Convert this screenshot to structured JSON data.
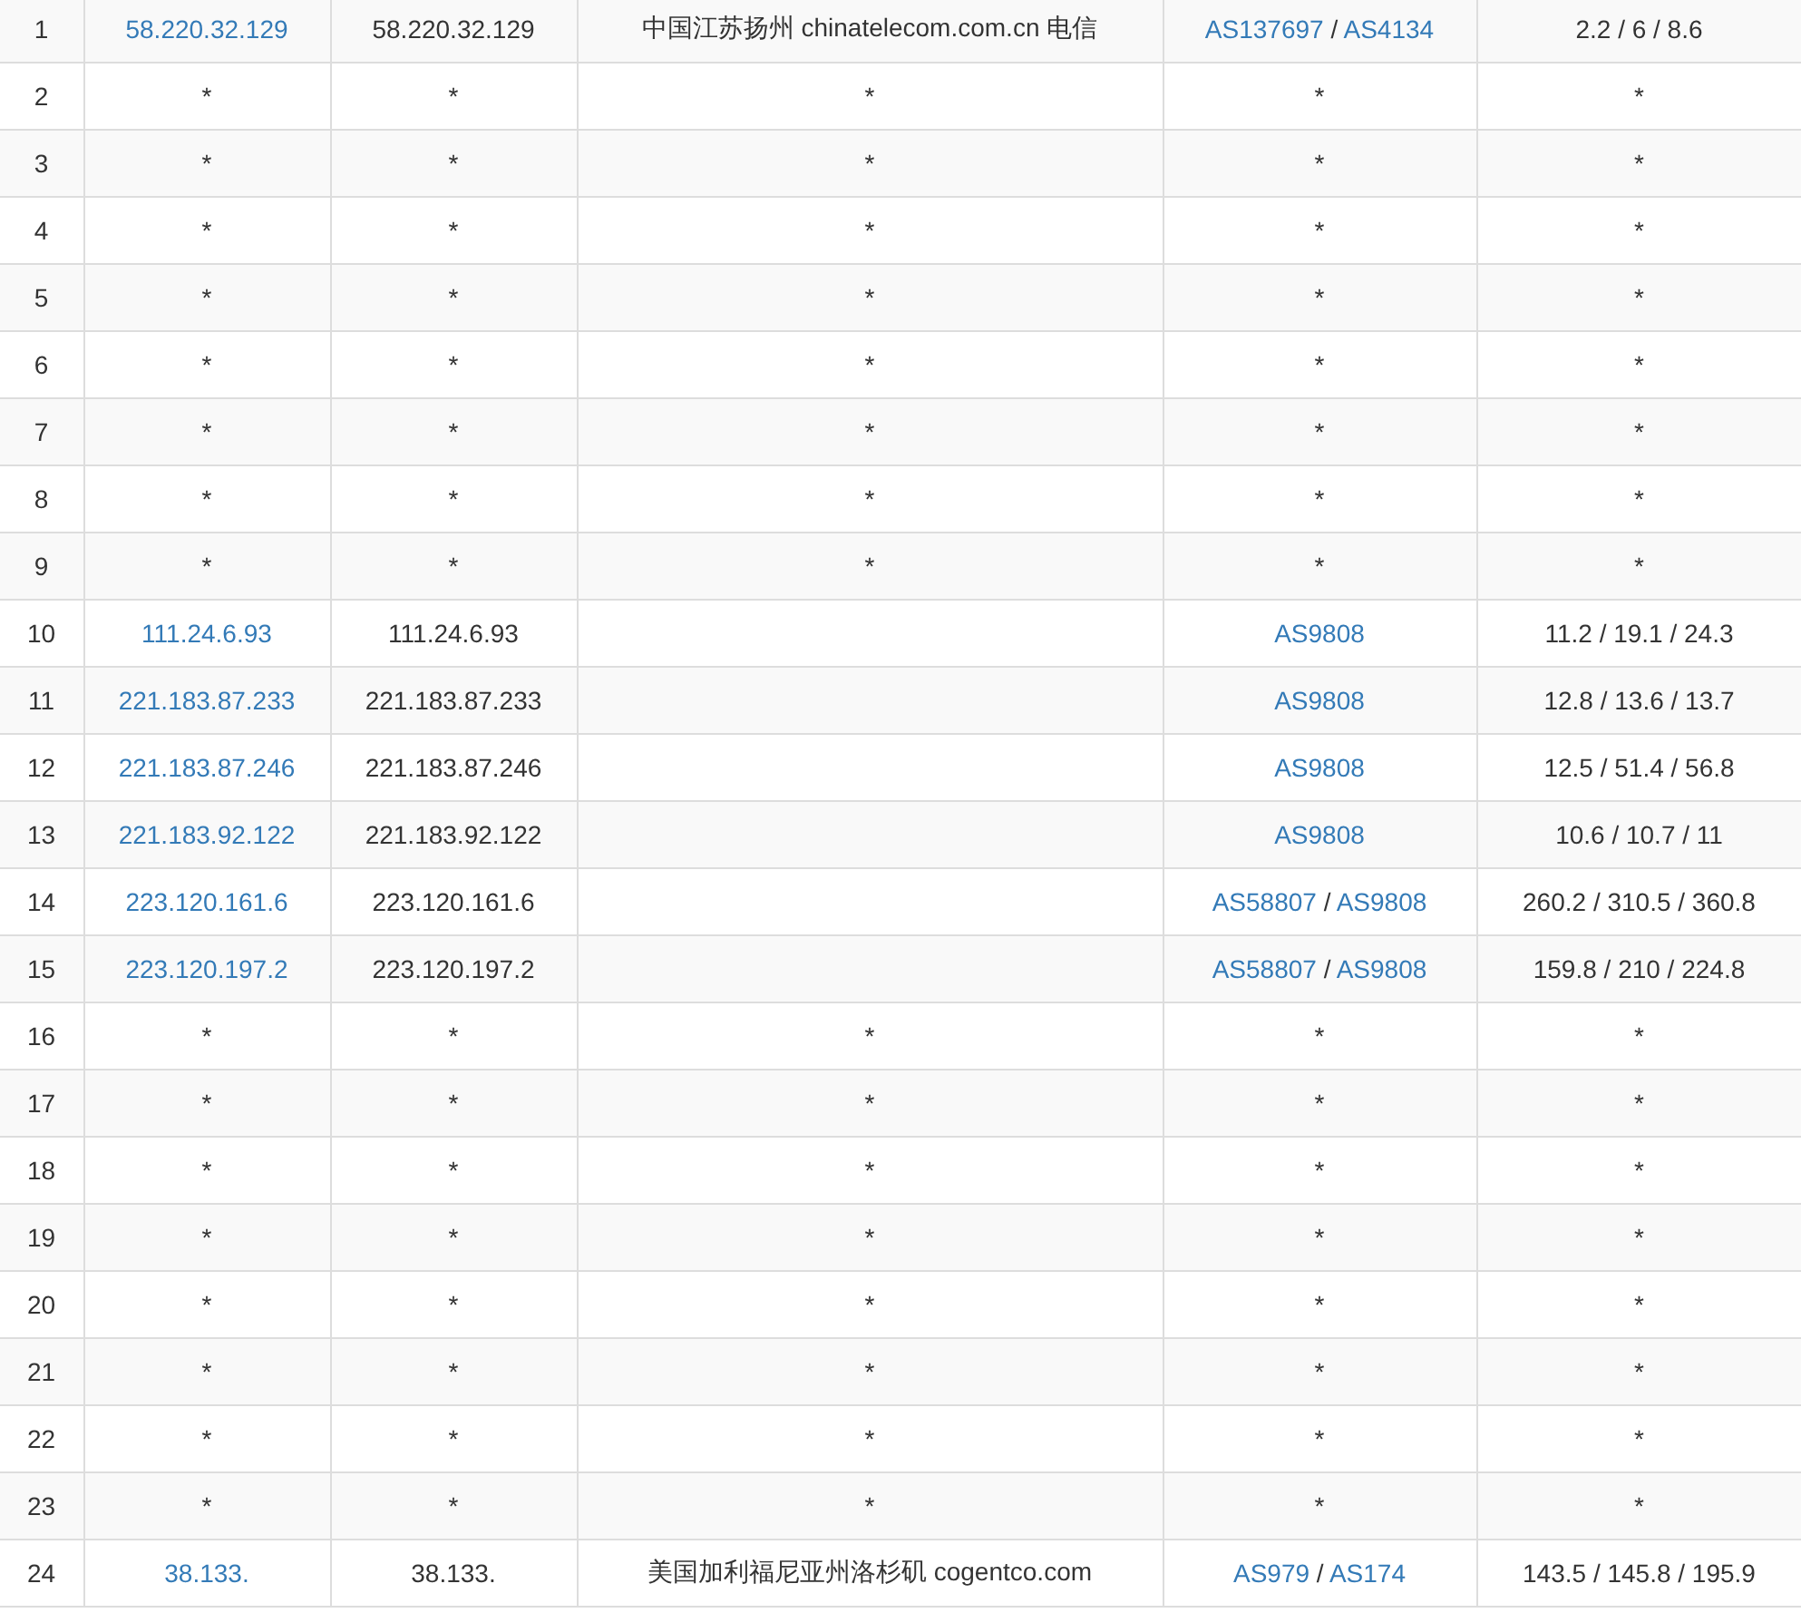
{
  "rows": [
    {
      "hop": "1",
      "ip": {
        "text": "58.220.32.129",
        "kind": "link"
      },
      "host": "58.220.32.129",
      "location": "中国江苏扬州 chinatelecom.com.cn 电信",
      "as": [
        {
          "text": "AS137697",
          "kind": "link"
        },
        {
          "text": " / ",
          "kind": "text"
        },
        {
          "text": "AS4134",
          "kind": "link"
        }
      ],
      "rtt": "2.2 / 6 / 8.6"
    },
    {
      "hop": "2",
      "ip": {
        "text": "*",
        "kind": "text"
      },
      "host": "*",
      "location": "*",
      "as": [
        {
          "text": "*",
          "kind": "text"
        }
      ],
      "rtt": "*"
    },
    {
      "hop": "3",
      "ip": {
        "text": "*",
        "kind": "text"
      },
      "host": "*",
      "location": "*",
      "as": [
        {
          "text": "*",
          "kind": "text"
        }
      ],
      "rtt": "*"
    },
    {
      "hop": "4",
      "ip": {
        "text": "*",
        "kind": "text"
      },
      "host": "*",
      "location": "*",
      "as": [
        {
          "text": "*",
          "kind": "text"
        }
      ],
      "rtt": "*"
    },
    {
      "hop": "5",
      "ip": {
        "text": "*",
        "kind": "text"
      },
      "host": "*",
      "location": "*",
      "as": [
        {
          "text": "*",
          "kind": "text"
        }
      ],
      "rtt": "*"
    },
    {
      "hop": "6",
      "ip": {
        "text": "*",
        "kind": "text"
      },
      "host": "*",
      "location": "*",
      "as": [
        {
          "text": "*",
          "kind": "text"
        }
      ],
      "rtt": "*"
    },
    {
      "hop": "7",
      "ip": {
        "text": "*",
        "kind": "text"
      },
      "host": "*",
      "location": "*",
      "as": [
        {
          "text": "*",
          "kind": "text"
        }
      ],
      "rtt": "*"
    },
    {
      "hop": "8",
      "ip": {
        "text": "*",
        "kind": "text"
      },
      "host": "*",
      "location": "*",
      "as": [
        {
          "text": "*",
          "kind": "text"
        }
      ],
      "rtt": "*"
    },
    {
      "hop": "9",
      "ip": {
        "text": "*",
        "kind": "text"
      },
      "host": "*",
      "location": "*",
      "as": [
        {
          "text": "*",
          "kind": "text"
        }
      ],
      "rtt": "*"
    },
    {
      "hop": "10",
      "ip": {
        "text": "111.24.6.93",
        "kind": "link"
      },
      "host": "111.24.6.93",
      "as": [
        {
          "text": "AS9808",
          "kind": "link"
        }
      ],
      "rtt": "11.2 / 19.1 / 24.3"
    },
    {
      "hop": "11",
      "ip": {
        "text": "221.183.87.233",
        "kind": "link"
      },
      "host": "221.183.87.233",
      "as": [
        {
          "text": "AS9808",
          "kind": "link"
        }
      ],
      "rtt": "12.8 / 13.6 / 13.7"
    },
    {
      "hop": "12",
      "ip": {
        "text": "221.183.87.246",
        "kind": "link"
      },
      "host": "221.183.87.246",
      "as": [
        {
          "text": "AS9808",
          "kind": "link"
        }
      ],
      "rtt": "12.5 / 51.4 / 56.8"
    },
    {
      "hop": "13",
      "ip": {
        "text": "221.183.92.122",
        "kind": "link"
      },
      "host": "221.183.92.122",
      "as": [
        {
          "text": "AS9808",
          "kind": "link"
        }
      ],
      "rtt": "10.6 / 10.7 / 11"
    },
    {
      "hop": "14",
      "ip": {
        "text": "223.120.161.6",
        "kind": "link"
      },
      "host": "223.120.161.6",
      "as": [
        {
          "text": "AS58807",
          "kind": "link"
        },
        {
          "text": " / ",
          "kind": "text"
        },
        {
          "text": "AS9808",
          "kind": "link"
        }
      ],
      "rtt": "260.2 / 310.5 / 360.8"
    },
    {
      "hop": "15",
      "ip": {
        "text": "223.120.197.2",
        "kind": "link"
      },
      "host": "223.120.197.2",
      "as": [
        {
          "text": "AS58807",
          "kind": "link"
        },
        {
          "text": " / ",
          "kind": "text"
        },
        {
          "text": "AS9808",
          "kind": "link"
        }
      ],
      "rtt": "159.8 / 210 / 224.8"
    },
    {
      "hop": "16",
      "ip": {
        "text": "*",
        "kind": "text"
      },
      "host": "*",
      "location": "*",
      "as": [
        {
          "text": "*",
          "kind": "text"
        }
      ],
      "rtt": "*"
    },
    {
      "hop": "17",
      "ip": {
        "text": "*",
        "kind": "text"
      },
      "host": "*",
      "location": "*",
      "as": [
        {
          "text": "*",
          "kind": "text"
        }
      ],
      "rtt": "*"
    },
    {
      "hop": "18",
      "ip": {
        "text": "*",
        "kind": "text"
      },
      "host": "*",
      "location": "*",
      "as": [
        {
          "text": "*",
          "kind": "text"
        }
      ],
      "rtt": "*"
    },
    {
      "hop": "19",
      "ip": {
        "text": "*",
        "kind": "text"
      },
      "host": "*",
      "location": "*",
      "as": [
        {
          "text": "*",
          "kind": "text"
        }
      ],
      "rtt": "*"
    },
    {
      "hop": "20",
      "ip": {
        "text": "*",
        "kind": "text"
      },
      "host": "*",
      "location": "*",
      "as": [
        {
          "text": "*",
          "kind": "text"
        }
      ],
      "rtt": "*"
    },
    {
      "hop": "21",
      "ip": {
        "text": "*",
        "kind": "text"
      },
      "host": "*",
      "location": "*",
      "as": [
        {
          "text": "*",
          "kind": "text"
        }
      ],
      "rtt": "*"
    },
    {
      "hop": "22",
      "ip": {
        "text": "*",
        "kind": "text"
      },
      "host": "*",
      "location": "*",
      "as": [
        {
          "text": "*",
          "kind": "text"
        }
      ],
      "rtt": "*"
    },
    {
      "hop": "23",
      "ip": {
        "text": "*",
        "kind": "text"
      },
      "host": "*",
      "location": "*",
      "as": [
        {
          "text": "*",
          "kind": "text"
        }
      ],
      "rtt": "*"
    },
    {
      "hop": "24",
      "ip": {
        "text": "38.133.",
        "kind": "link"
      },
      "host": "38.133.",
      "location": "美国加利福尼亚州洛杉矶 cogentco.com",
      "as": [
        {
          "text": "AS979",
          "kind": "link"
        },
        {
          "text": " / ",
          "kind": "text"
        },
        {
          "text": "AS174",
          "kind": "link"
        }
      ],
      "rtt": "143.5 / 145.8 / 195.9"
    }
  ]
}
